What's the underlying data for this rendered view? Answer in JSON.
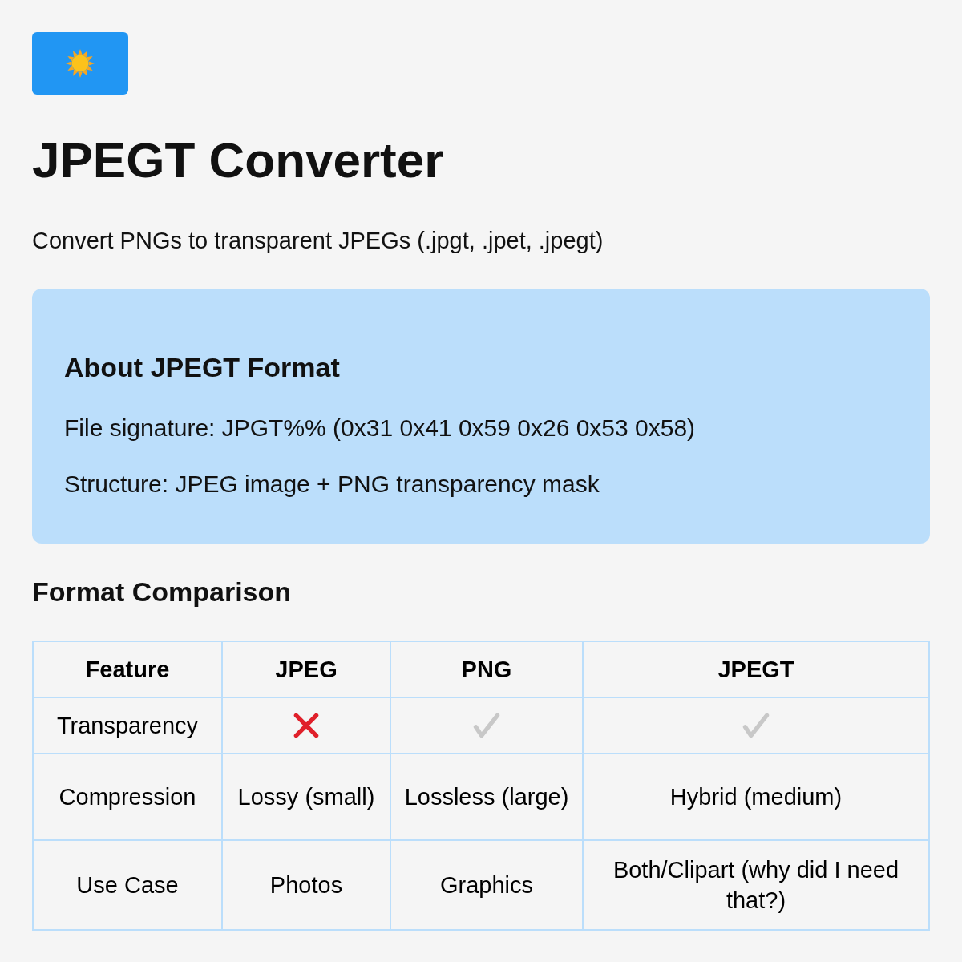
{
  "logo": {
    "kind": "sun"
  },
  "title": "JPEGT Converter",
  "subtitle": "Convert PNGs to transparent JPEGs (.jpgt, .jpet, .jpegt)",
  "info_box": {
    "heading": "About JPEGT Format",
    "lines": [
      "File signature: JPGT%% (0x31 0x41 0x59 0x26 0x53 0x58)",
      "Structure: JPEG image + PNG transparency mask"
    ]
  },
  "comparison": {
    "heading": "Format Comparison",
    "columns": [
      "Feature",
      "JPEG",
      "PNG",
      "JPEGT"
    ],
    "rows": [
      [
        {
          "kind": "text",
          "text": "Transparency"
        },
        {
          "kind": "cross"
        },
        {
          "kind": "check"
        },
        {
          "kind": "check"
        }
      ],
      [
        {
          "kind": "text",
          "text": "Compression"
        },
        {
          "kind": "text",
          "text": "Lossy (small)"
        },
        {
          "kind": "text",
          "text": "Lossless (large)"
        },
        {
          "kind": "text",
          "text": "Hybrid (medium)"
        }
      ],
      [
        {
          "kind": "text",
          "text": "Use Case"
        },
        {
          "kind": "text",
          "text": "Photos"
        },
        {
          "kind": "text",
          "text": "Graphics"
        },
        {
          "kind": "text",
          "text": "Both/Clipart (why did I need that?)"
        }
      ]
    ]
  }
}
